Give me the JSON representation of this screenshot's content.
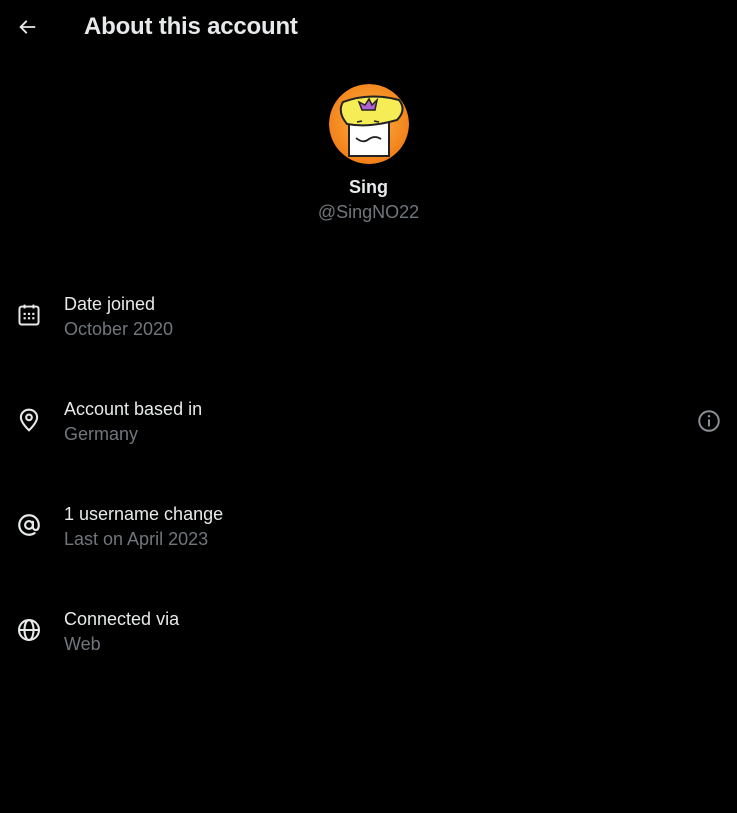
{
  "header": {
    "title": "About this account",
    "back_icon": "arrow-left-icon"
  },
  "profile": {
    "display_name": "Sing",
    "handle": "@SingNO22",
    "avatar_bg": "#f28a1e"
  },
  "rows": [
    {
      "icon": "calendar-icon",
      "label": "Date joined",
      "value": "October 2020"
    },
    {
      "icon": "location-pin-icon",
      "label": "Account based in",
      "value": "Germany",
      "info_icon": "info-icon"
    },
    {
      "icon": "at-sign-icon",
      "label": "1 username change",
      "value": "Last on April 2023"
    },
    {
      "icon": "globe-icon",
      "label": "Connected via",
      "value": "Web"
    }
  ],
  "colors": {
    "background": "#000000",
    "primary_text": "#e7e9ea",
    "secondary_text": "#71767b"
  }
}
